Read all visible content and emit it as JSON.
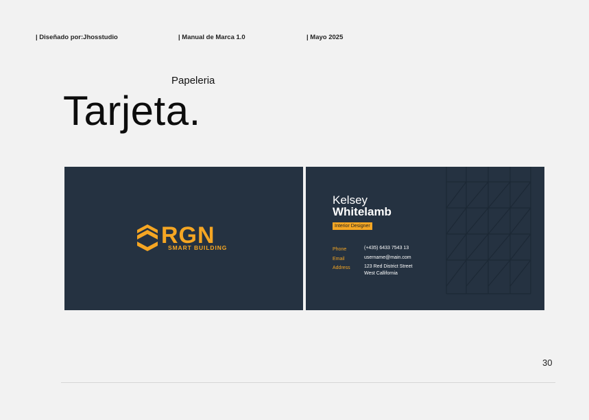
{
  "header": {
    "designer": "| Diseñado por:Jhosstudio",
    "manual": "| Manual de Marca 1.0",
    "date": "| Mayo 2025"
  },
  "section": {
    "subtitle": "Papeleria",
    "title": "Tarjeta."
  },
  "card_front": {
    "logo_text": "RGN",
    "logo_tagline": "SMART BUILDING",
    "background": "#253241",
    "accent": "#f5a623"
  },
  "card_back": {
    "first_name": "Kelsey",
    "last_name": "Whitelamb",
    "role": "Interior Designer",
    "contacts": {
      "phone_label": "Phone",
      "phone": "(+435) 6433 7543 13",
      "email_label": "Email",
      "email": "username@main.com",
      "address_label": "Address",
      "address_line1": "123 Red District Street",
      "address_line2": "West Callifornia"
    }
  },
  "footer": {
    "page_number": "30"
  }
}
